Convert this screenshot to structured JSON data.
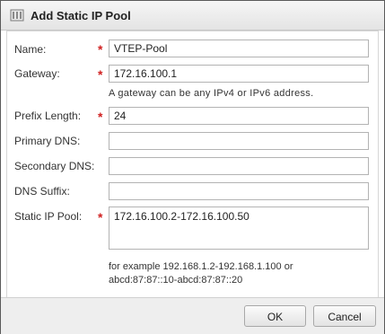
{
  "dialog": {
    "title": "Add Static IP Pool",
    "title_icon": "network-pool-icon"
  },
  "form": {
    "name": {
      "label": "Name:",
      "value": "VTEP-Pool",
      "required_mark": "*"
    },
    "gateway": {
      "label": "Gateway:",
      "value": "172.16.100.1",
      "required_mark": "*",
      "hint": "A gateway can be any IPv4 or IPv6 address."
    },
    "prefix_length": {
      "label": "Prefix Length:",
      "value": "24",
      "required_mark": "*"
    },
    "primary_dns": {
      "label": "Primary DNS:",
      "value": ""
    },
    "secondary_dns": {
      "label": "Secondary DNS:",
      "value": ""
    },
    "dns_suffix": {
      "label": "DNS Suffix:",
      "value": ""
    },
    "static_ip_pool": {
      "label": "Static IP Pool:",
      "value": "172.16.100.2-172.16.100.50",
      "required_mark": "*",
      "example_line1": "for example 192.168.1.2-192.168.1.100 or",
      "example_line2": "abcd:87:87::10-abcd:87:87::20"
    }
  },
  "footer": {
    "ok_label": "OK",
    "cancel_label": "Cancel"
  }
}
